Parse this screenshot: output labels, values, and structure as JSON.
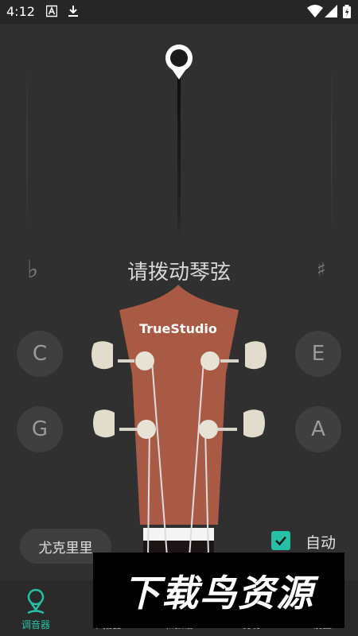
{
  "status_bar": {
    "time": "4:12",
    "icons": [
      "a-icon",
      "download-icon",
      "wifi-icon",
      "signal-icon",
      "battery-icon"
    ]
  },
  "tuner": {
    "flat_symbol": "♭",
    "sharp_symbol": "♯",
    "prompt": "请拨动琴弦",
    "brand": "TrueStudio",
    "strings": [
      {
        "label": "C"
      },
      {
        "label": "E"
      },
      {
        "label": "G"
      },
      {
        "label": "A"
      }
    ]
  },
  "instrument_button": "尤克里里",
  "auto": {
    "label": "自动",
    "checked": true
  },
  "bottom_nav": [
    {
      "label": "调音器",
      "active": true
    },
    {
      "label": "节拍器",
      "active": false
    },
    {
      "label": "和弦谱",
      "active": false
    },
    {
      "label": "发现",
      "active": false
    },
    {
      "label": "设置",
      "active": false
    }
  ],
  "watermark": "下载鸟资源",
  "colors": {
    "accent": "#27c0a6",
    "headstock": "#a85a45",
    "background": "#303030"
  }
}
